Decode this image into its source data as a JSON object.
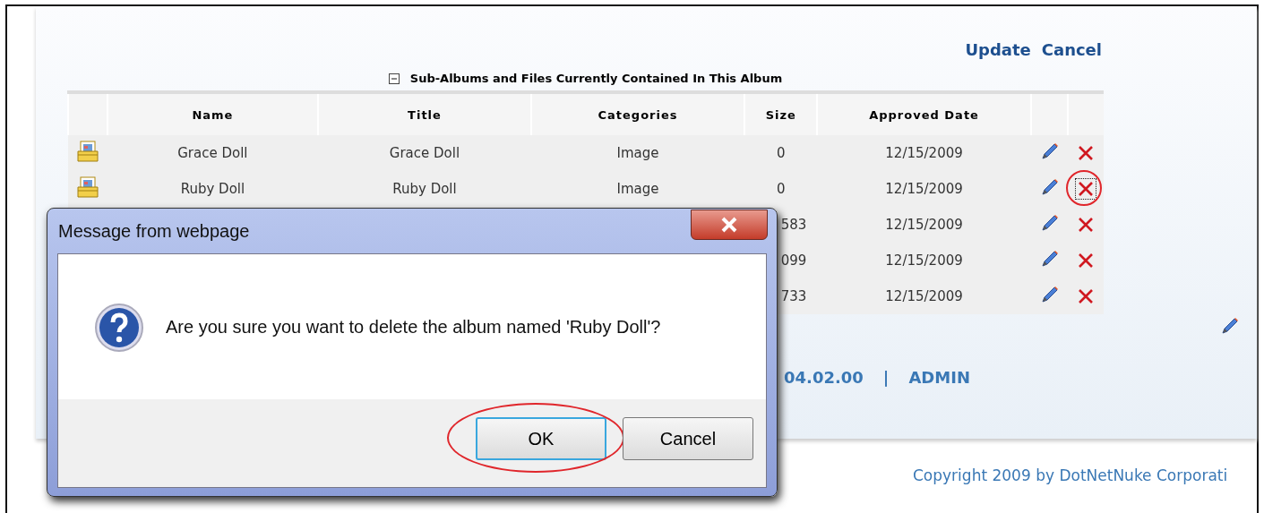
{
  "actions": [
    {
      "label": "Update"
    },
    {
      "label": "Cancel"
    }
  ],
  "section": {
    "title": "Sub-Albums and Files Currently Contained In This Album",
    "expanded": true
  },
  "table": {
    "columns": [
      "Name",
      "Title",
      "Categories",
      "Size",
      "Approved Date"
    ],
    "rows": [
      {
        "kind": "album",
        "name": "Grace Doll",
        "title": "Grace Doll",
        "category": "Image",
        "size": "0",
        "date": "12/15/2009",
        "focused": false,
        "highlighted": false
      },
      {
        "kind": "album",
        "name": "Ruby Doll",
        "title": "Ruby Doll",
        "category": "Image",
        "size": "0",
        "date": "12/15/2009",
        "focused": true,
        "highlighted": true
      },
      {
        "size": "583",
        "date": "12/15/2009",
        "focused": false,
        "highlighted": false
      },
      {
        "size": "099",
        "date": "12/15/2009",
        "focused": false,
        "highlighted": false
      },
      {
        "size": "733",
        "date": "12/15/2009",
        "focused": false,
        "highlighted": false
      }
    ]
  },
  "footer": {
    "version": "04.02.00",
    "separator": "|",
    "link": "ADMIN"
  },
  "copyright": "Copyright 2009 by DotNetNuke Corporati",
  "dialog": {
    "title": "Message from webpage",
    "message": "Are you sure you want to delete the album named 'Ruby Doll'?",
    "buttons": [
      {
        "label": "OK",
        "focused": true,
        "highlighted": true
      },
      {
        "label": "Cancel",
        "focused": false,
        "highlighted": false
      }
    ]
  }
}
